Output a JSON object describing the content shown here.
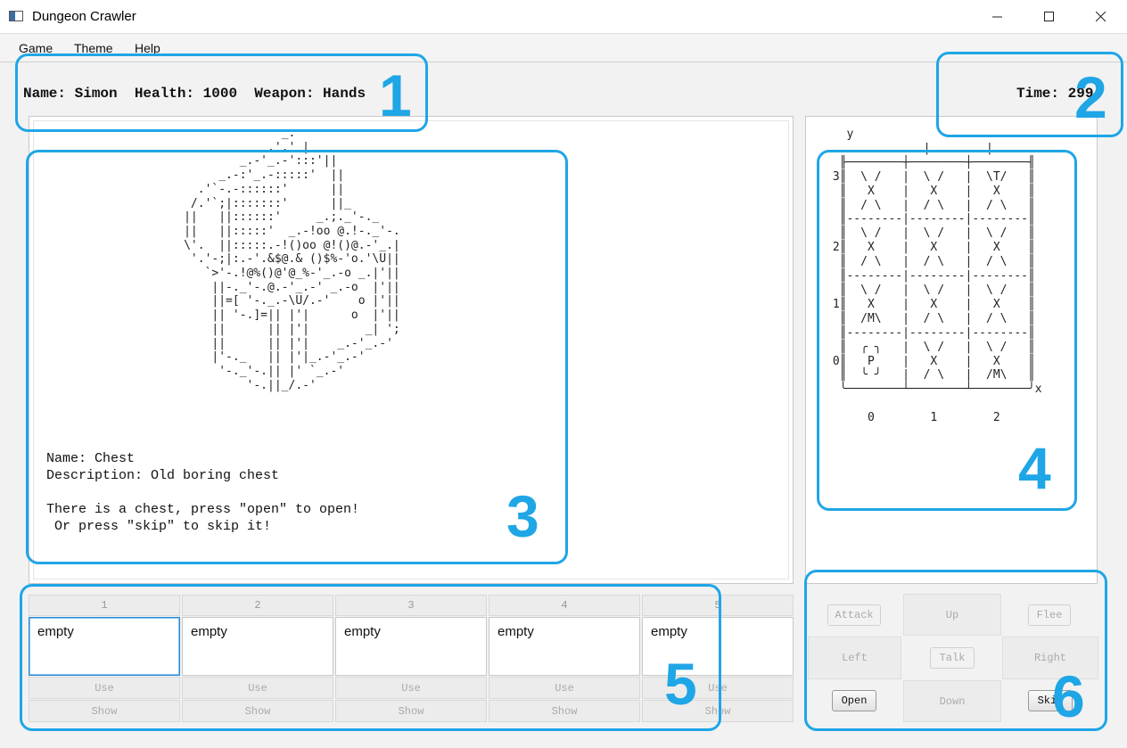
{
  "window": {
    "title": "Dungeon Crawler",
    "minimize": "—",
    "maximize": "☐",
    "close": "✕"
  },
  "menu": [
    "Game",
    "Theme",
    "Help"
  ],
  "status": {
    "player": "Name: Simon  Health: 1000  Weapon: Hands",
    "time": "Time: 299"
  },
  "chest_art": "                         _.\n                       .'.' |\n                   _.-'_.-':::'||\n                _.-:'_.-:::::'  ||\n             .'`-.-::::::'      ||\n            /.'`;|:::::::'      ||_\n           ||   ||::::::'     _.;._'-._\n           ||   ||:::::'  _.-!oo @.!-._'-.\n           \\'.  ||:::::.-!()oo @!()@.-'_.|\n            '.'-;|:.-'.&$@.& ()$%-'o.'\\U||\n              `>'-.!@%()@'@_%-'_.-o _.|'||\n               ||-._'-.@.-'_.-' _.-o  |'||\n               ||=[ '-._.-\\U/.-'    o |'||\n               || '-.]=|| |'|      o  |'||\n               ||      || |'|        _| ';\n               ||      || |'|    _.-'_.-'\n               |'-._   || |'|_.-'_.-'\n                '-._'-.|| |' `_.-'\n                    '-.||_/.-'",
  "encounter": {
    "name": "Name: Chest",
    "description": "Description: Old boring chest",
    "prompt": "There is a chest, press \"open\" to open!\n Or press \"skip\" to skip it!"
  },
  "map_text": "   y\n              |        |\n  ╟────────┼────────┼────────╢\n 3║  \\ /   |  \\ /   |  \\T/   ║\n  ║   X    |   X    |   X    ║\n  ║  / \\   |  / \\   |  / \\   ║\n  ║--------|--------|--------║\n  ║  \\ /   |  \\ /   |  \\ /   ║\n 2║   X    |   X    |   X    ║\n  ║  / \\   |  / \\   |  / \\   ║\n  ║--------|--------|--------║\n  ║  \\ /   |  \\ /   |  \\ /   ║\n 1║   X    |   X    |   X    ║\n  ║  /M\\   |  / \\   |  / \\   ║\n  ║--------|--------|--------║\n  ║  ╭ ╮   |  \\ /   |  \\ /   ║\n 0║   P    |   X    |   X    ║\n  ║  ╰ ╯   |  / \\   |  /M\\   ║\n  ╰────────┴────────┴────────╯x\n\n      0        1        2",
  "inventory": {
    "slots": [
      "1",
      "2",
      "3",
      "4",
      "5"
    ],
    "items": [
      "empty",
      "empty",
      "empty",
      "empty",
      "empty"
    ],
    "use_label": "Use",
    "show_label": "Show"
  },
  "controls": {
    "attack": "Attack",
    "up": "Up",
    "flee": "Flee",
    "left": "Left",
    "talk": "Talk",
    "right": "Right",
    "open": "Open",
    "down": "Down",
    "skip": "Skip"
  },
  "annotations": [
    "1",
    "2",
    "3",
    "4",
    "5",
    "6"
  ],
  "colors": {
    "annotation": "#1fa6e6",
    "selected_border": "#2a8ad4"
  }
}
